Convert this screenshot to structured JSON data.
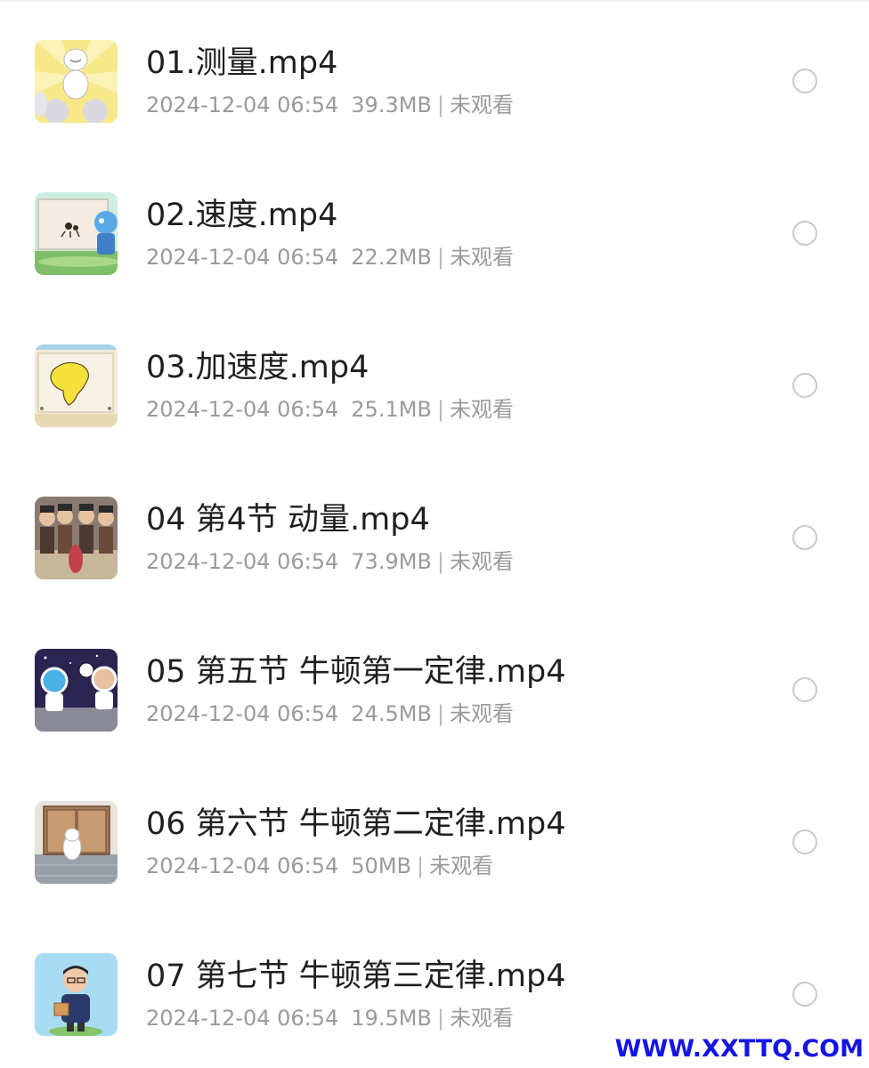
{
  "files": [
    {
      "name": "01.测量.mp4",
      "date": "2024-12-04 06:54",
      "size": "39.3MB",
      "status": "未观看",
      "thumbnail": "cartoon-figure-meditating-thumbnail"
    },
    {
      "name": "02.速度.mp4",
      "date": "2024-12-04 06:54",
      "size": "22.2MB",
      "status": "未观看",
      "thumbnail": "ant-and-robot-thumbnail"
    },
    {
      "name": "03.加速度.mp4",
      "date": "2024-12-04 06:54",
      "size": "25.1MB",
      "status": "未观看",
      "thumbnail": "africa-map-thumbnail"
    },
    {
      "name": "04 第4节 动量.mp4",
      "date": "2024-12-04 06:54",
      "size": "73.9MB",
      "status": "未观看",
      "thumbnail": "crowd-scene-thumbnail"
    },
    {
      "name": "05 第五节 牛顿第一定律.mp4",
      "date": "2024-12-04 06:54",
      "size": "24.5MB",
      "status": "未观看",
      "thumbnail": "astronauts-space-thumbnail"
    },
    {
      "name": "06 第六节 牛顿第二定律.mp4",
      "date": "2024-12-04 06:54",
      "size": "50MB",
      "status": "未观看",
      "thumbnail": "figure-at-doors-thumbnail"
    },
    {
      "name": "07 第七节 牛顿第三定律.mp4",
      "date": "2024-12-04 06:54",
      "size": "19.5MB",
      "status": "未观看",
      "thumbnail": "teacher-with-book-thumbnail"
    }
  ],
  "watermark": "WWW.XXTTQ.COM",
  "colors": {
    "title": "#1f1f1f",
    "meta": "#9a9a9a",
    "radio_border": "#c9c9c9",
    "watermark": "#1414e6"
  }
}
